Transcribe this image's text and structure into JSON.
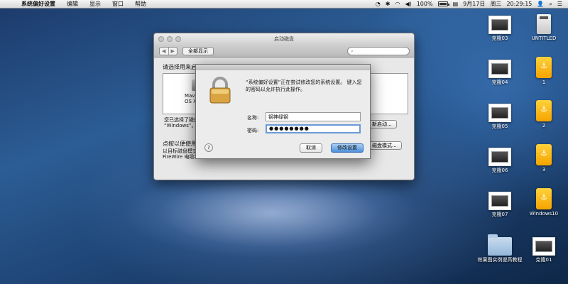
{
  "menubar": {
    "app": "系统偏好设置",
    "menus": [
      "编辑",
      "显示",
      "窗口",
      "帮助"
    ],
    "battery": "100%",
    "date": "9月17日",
    "weekday": "周三",
    "time": "20:29:15"
  },
  "window": {
    "title": "启动磁盘",
    "show_all": "全部显示",
    "heading": "请选择用来启动电脑的系统",
    "disk_label_1": "Mavericks",
    "disk_label_2": "OS X, 10.9.",
    "desc1_line1": "您已选择了磁盘",
    "desc1_line2": "“Windows”。",
    "restart_button": "新启动...",
    "desc2": "点按以便使用目",
    "desc3_line1": "以目标磁盘模式",
    "desc3_line2": "FireWire 电缆将",
    "target_button": "磁盘模式..."
  },
  "dialog": {
    "message": "“系统偏好设置”正在尝试修改您的系统设置。 键入您的密码以允许执行此操作。",
    "name_label": "名称:",
    "name_value": "钢神绿钢",
    "password_label": "密码:",
    "password_value": "●●●●●●●●",
    "help": "?",
    "cancel": "取消",
    "confirm": "修改设置"
  },
  "desktop": {
    "icons": [
      {
        "label": "克隆03",
        "kind": "screenshot"
      },
      {
        "label": "UNTITLED",
        "kind": "drive"
      },
      {
        "label": "克隆04",
        "kind": "screenshot"
      },
      {
        "label": "1",
        "kind": "usb"
      },
      {
        "label": "克隆05",
        "kind": "screenshot"
      },
      {
        "label": "2",
        "kind": "usb"
      },
      {
        "label": "克隆06",
        "kind": "screenshot"
      },
      {
        "label": "3",
        "kind": "usb"
      },
      {
        "label": "克隆07",
        "kind": "screenshot"
      },
      {
        "label": "Windows10",
        "kind": "usb"
      },
      {
        "label": "效果图实例提高教程",
        "kind": "folder"
      },
      {
        "label": "克隆01",
        "kind": "screenshot"
      }
    ]
  },
  "colors": {
    "primary_button": "#4e8fdb",
    "usb_icon": "#f5a300"
  }
}
